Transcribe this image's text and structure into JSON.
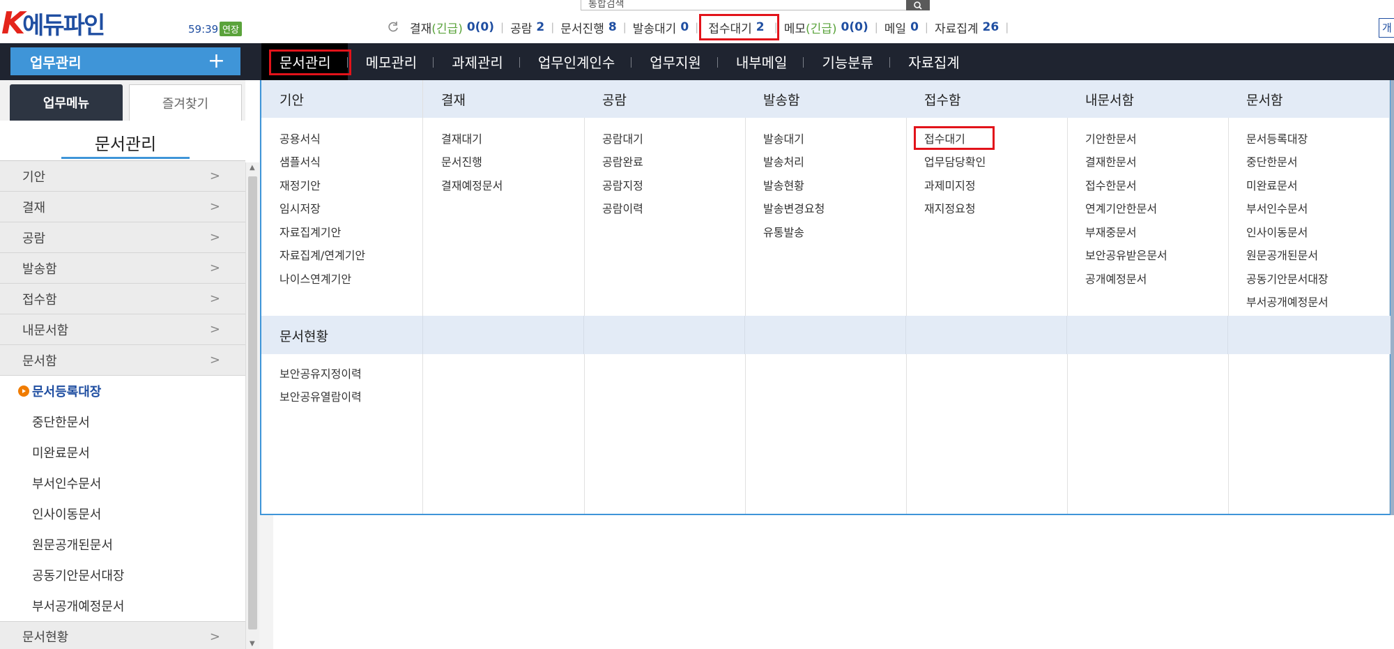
{
  "header": {
    "logo_k": "K",
    "logo_text": "에듀파인",
    "session_timer": "59:39",
    "extend_label": "연장",
    "search_placeholder": "통합검색",
    "right_edge_text": "개"
  },
  "status_bar": [
    {
      "label": "결재",
      "urgent_label": "(긴급)",
      "value": "0(0)"
    },
    {
      "label": "공람",
      "value": "2"
    },
    {
      "label": "문서진행",
      "value": "8"
    },
    {
      "label": "발송대기",
      "value": "0"
    },
    {
      "label": "접수대기",
      "value": "2",
      "highlighted": true
    },
    {
      "label": "메모",
      "urgent_label": "(긴급)",
      "value": "0(0)"
    },
    {
      "label": "메일",
      "value": "0"
    },
    {
      "label": "자료집계",
      "value": "26"
    }
  ],
  "nav": {
    "work_menu_label": "업무관리",
    "work_menu_plus": "+",
    "items": [
      "문서관리",
      "메모관리",
      "과제관리",
      "업무인계인수",
      "업무지원",
      "내부메일",
      "기능분류",
      "자료집계"
    ]
  },
  "sidebar": {
    "tabs": [
      "업무메뉴",
      "즐겨찾기"
    ],
    "title": "문서관리",
    "groups": [
      "기안",
      "결재",
      "공람",
      "발송함",
      "접수함",
      "내문서함",
      "문서함"
    ],
    "sub_items": [
      "문서등록대장",
      "중단한문서",
      "미완료문서",
      "부서인수문서",
      "인사이동문서",
      "원문공개된문서",
      "공동기안문서대장",
      "부서공개예정문서"
    ],
    "bottom_group": "문서현황",
    "chevron": ">"
  },
  "mega_menu": {
    "columns": [
      {
        "head": "기안",
        "links": [
          "공용서식",
          "샘플서식",
          "재정기안",
          "임시저장",
          "자료집계기안",
          "자료집계/연계기안",
          "나이스연계기안"
        ]
      },
      {
        "head": "결재",
        "links": [
          "결재대기",
          "문서진행",
          "결재예정문서"
        ]
      },
      {
        "head": "공람",
        "links": [
          "공람대기",
          "공람완료",
          "공람지정",
          "공람이력"
        ]
      },
      {
        "head": "발송함",
        "links": [
          "발송대기",
          "발송처리",
          "발송현황",
          "발송변경요청",
          "유통발송"
        ]
      },
      {
        "head": "접수함",
        "links": [
          "접수대기",
          "업무담당확인",
          "과제미지정",
          "재지정요청"
        ]
      },
      {
        "head": "내문서함",
        "links": [
          "기안한문서",
          "결재한문서",
          "접수한문서",
          "연계기안한문서",
          "부재중문서",
          "보안공유받은문서",
          "공개예정문서"
        ]
      },
      {
        "head": "문서함",
        "links": [
          "문서등록대장",
          "중단한문서",
          "미완료문서",
          "부서인수문서",
          "인사이동문서",
          "원문공개된문서",
          "공동기안문서대장",
          "부서공개예정문서"
        ]
      }
    ],
    "section2": {
      "head": "문서현황",
      "links": [
        "보안공유지정이력",
        "보안공유열람이력"
      ]
    }
  },
  "colors": {
    "nav_bg": "#1f2430",
    "accent_blue": "#3f95d8",
    "highlight_red": "#e2131a",
    "menu_head_bg": "#e3ebf6",
    "active_orange": "#f07c00"
  }
}
